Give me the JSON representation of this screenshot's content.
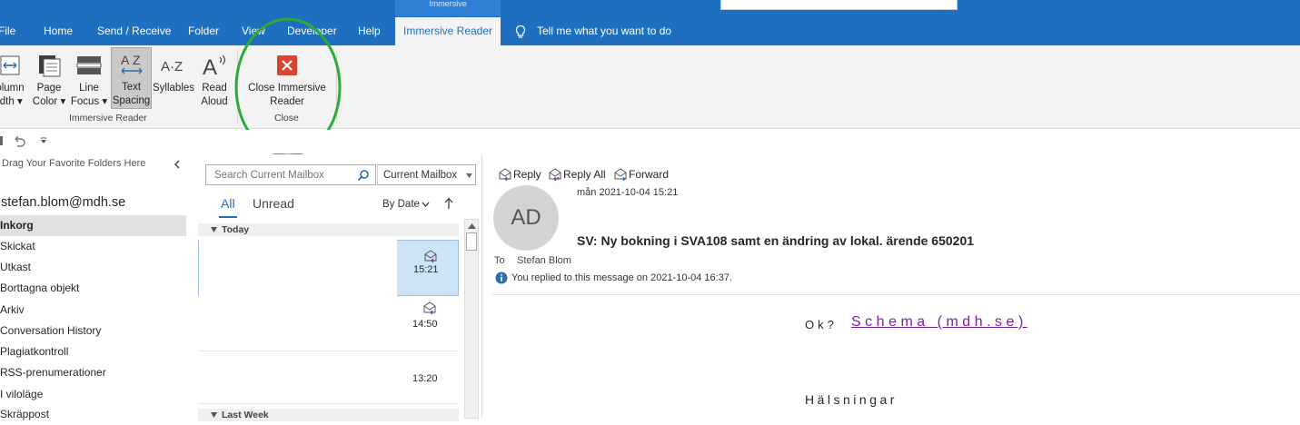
{
  "ribbon_tabs": {
    "file": "File",
    "home": "Home",
    "send_receive": "Send / Receive",
    "folder": "Folder",
    "view": "View",
    "developer": "Developer",
    "help": "Help",
    "immersive_reader": "Immersive Reader",
    "contextual_label": "Immersive",
    "tell_me": "Tell me what you want to do"
  },
  "ribbon": {
    "column_width": [
      "olumn",
      "idth ▾"
    ],
    "page_color": [
      "Page",
      "Color ▾"
    ],
    "line_focus": [
      "Line",
      "Focus ▾"
    ],
    "text_spacing": [
      "Text",
      "Spacing"
    ],
    "syllables": "Syllables",
    "read_aloud": [
      "Read",
      "Aloud"
    ],
    "close_immersive": [
      "Close Immersive",
      "Reader"
    ],
    "group_immersive": "Immersive Reader",
    "group_close": "Close",
    "annotation_color": "#2eaa3c",
    "close_icon_color": "#d9432f"
  },
  "folders": {
    "drag_hint": "Drag Your Favorite Folders Here",
    "account": "stefan.blom@mdh.se",
    "items": [
      "Inkorg",
      "Skickat",
      "Utkast",
      "Borttagna objekt",
      "Arkiv",
      "Conversation History",
      "Plagiatkontroll",
      "RSS-prenumerationer",
      "I viloläge",
      "Skräppost"
    ]
  },
  "list": {
    "search_placeholder": "Search Current Mailbox",
    "scope": "Current Mailbox",
    "filter_all": "All",
    "filter_unread": "Unread",
    "sort": "By Date",
    "group_today": "Today",
    "group_last_week": "Last Week",
    "times": [
      "15:21",
      "14:50",
      "13:20"
    ],
    "selected_color": "#cde4f7"
  },
  "message": {
    "reply": "Reply",
    "reply_all": "Reply All",
    "forward": "Forward",
    "date": "mån 2021-10-04 15:21",
    "avatar_initials": "AD",
    "subject": "SV: Ny bokning i SVA108 samt en ändring av lokal. ärende 650201",
    "to_label": "To",
    "to_value": "Stefan Blom",
    "info": "You replied to this message on 2021-10-04 16:37.",
    "body_ok": "Ok?",
    "body_link": "Schema (mdh.se)",
    "body_greeting": "Hälsningar",
    "link_color": "#7b1fa2"
  }
}
